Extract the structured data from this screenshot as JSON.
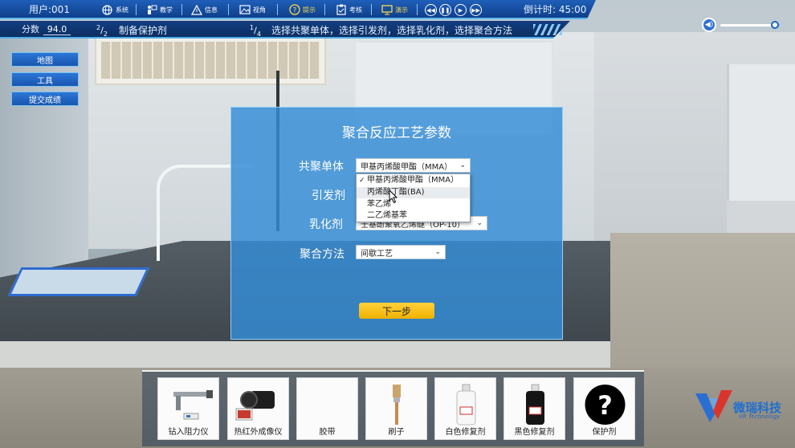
{
  "hud": {
    "user_label": "用户:001",
    "nav": [
      {
        "label": "系统",
        "icon": "globe-icon"
      },
      {
        "label": "教学",
        "icon": "teacher-icon"
      },
      {
        "label": "信息",
        "icon": "warning-icon"
      },
      {
        "label": "视角",
        "icon": "image-icon"
      },
      {
        "label": "提示",
        "icon": "help-icon"
      },
      {
        "label": "考核",
        "icon": "clipboard-icon"
      },
      {
        "label": "演示",
        "icon": "monitor-icon"
      }
    ],
    "countdown_label": "倒计时: 45:00",
    "score_label": "分数",
    "score_value": "94.0",
    "stage_current": "2",
    "stage_total": "2",
    "stage_title": "制备保护剂",
    "step_current": "1",
    "step_total": "4",
    "step_instruction": "选择共聚单体，选择引发剂，选择乳化剂，选择聚合方法"
  },
  "volume": {
    "level": 0.92
  },
  "left_menu": [
    "地图",
    "工具",
    "提交成绩"
  ],
  "dialog": {
    "title": "聚合反应工艺参数",
    "fields": [
      {
        "label": "共聚单体",
        "value": "甲基丙烯酸甲酯（MMA）"
      },
      {
        "label": "引发剂",
        "value": ""
      },
      {
        "label": "乳化剂",
        "value": "壬基酚聚氧乙烯醚（OP-10）"
      },
      {
        "label": "聚合方法",
        "value": "间歇工艺"
      }
    ],
    "dropdown_options": [
      "甲基丙烯酸甲酯（MMA）",
      "丙烯酸丁酯(BA)",
      "苯乙烯",
      "二乙烯基苯"
    ],
    "dropdown_selected_index": 0,
    "dropdown_hover_index": 1,
    "next_label": "下一步"
  },
  "tools": [
    {
      "label": "钻入阻力仪",
      "icon": "drill-resistance-meter-icon"
    },
    {
      "label": "热红外成像仪",
      "icon": "thermal-camera-icon"
    },
    {
      "label": "胶带",
      "icon": "tape-icon"
    },
    {
      "label": "刷子",
      "icon": "brush-icon"
    },
    {
      "label": "白色修复剂",
      "icon": "white-bottle-icon"
    },
    {
      "label": "黑色修复剂",
      "icon": "black-bottle-icon"
    },
    {
      "label": "保护剂",
      "icon": "question-icon"
    }
  ],
  "logo": {
    "name": "微瑞科技",
    "sub": "VR Technology",
    "color": "#1f6fd0"
  }
}
